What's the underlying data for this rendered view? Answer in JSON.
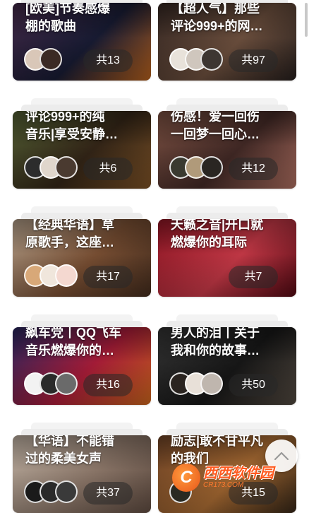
{
  "playlists": [
    {
      "title": "[欧美]节奏感爆\n棚的歌曲",
      "count": "共13",
      "bg": [
        "#4a2d50",
        "#1b1f3a",
        "#c86a20"
      ],
      "avatars": [
        "#d9c7b8",
        "#3b2a24"
      ]
    },
    {
      "title": "【超人气】那些\n评论999+的网…",
      "count": "共97",
      "bg": [
        "#3a2b26",
        "#7b5a46",
        "#2a2220"
      ],
      "avatars": [
        "#e8e2da",
        "#cfc6bd",
        "#3d3632"
      ]
    },
    {
      "title": "评论999+的纯\n音乐|享受安静…",
      "count": "共6",
      "bg": [
        "#5c6a3a",
        "#3a2a1a",
        "#8a5a2a"
      ],
      "avatars": [
        "#2c2c2c",
        "#e0d6cc",
        "#4a3a30"
      ]
    },
    {
      "title": "伤感！爱一回伤\n一回梦一回心…",
      "count": "共12",
      "bg": [
        "#8a5a4a",
        "#4a2e2a",
        "#c07a6a"
      ],
      "avatars": [
        "#3a3a30",
        "#b09a7a",
        "#2a2622"
      ]
    },
    {
      "title": "【经典华语】草\n原歌手，这座…",
      "count": "共17",
      "bg": [
        "#c8b29a",
        "#8a5a3a",
        "#4a3020"
      ],
      "avatars": [
        "#d8a878",
        "#f0e6dc",
        "#f4d8d0"
      ]
    },
    {
      "title": "天籁之音|开口就\n燃爆你的耳际",
      "count": "共7",
      "bg": [
        "#a01828",
        "#e04050",
        "#5a0a14"
      ],
      "avatars": []
    },
    {
      "title": "飙车党丨QQ飞车\n音乐燃爆你的…",
      "count": "共16",
      "bg": [
        "#2a2a6a",
        "#c02040",
        "#e07020"
      ],
      "avatars": [
        "#f2f2f2",
        "#2a2a2a",
        "#6a6a6a"
      ]
    },
    {
      "title": "男人的泪丨关于\n我和你的故事…",
      "count": "共50",
      "bg": [
        "#3a3a3a",
        "#1a1a1a",
        "#5a5046"
      ],
      "avatars": [
        "#2a2420",
        "#e8e0d8",
        "#bfb6ae"
      ]
    },
    {
      "title": "【华语】不能错\n过的柔美女声",
      "count": "共37",
      "bg": [
        "#d8c8b8",
        "#a08878",
        "#6a5448"
      ],
      "avatars": [
        "#1a1a1a",
        "#2a2a2a",
        "#3a3a3a"
      ]
    },
    {
      "title": "励志|敢不甘平凡\n的我们",
      "count": "共15",
      "bg": [
        "#7a4a2a",
        "#c07a3a",
        "#3a2a1a"
      ],
      "avatars": [
        "#2a2a22"
      ]
    }
  ],
  "watermark": {
    "logo": "C",
    "main": "西西软件园",
    "sub": "CR173.COM"
  },
  "colors": {
    "accent": "#ff5a1f",
    "countBg": "rgba(40,40,40,0.55)"
  },
  "icons": {
    "backtop": "chevron-up-icon"
  }
}
